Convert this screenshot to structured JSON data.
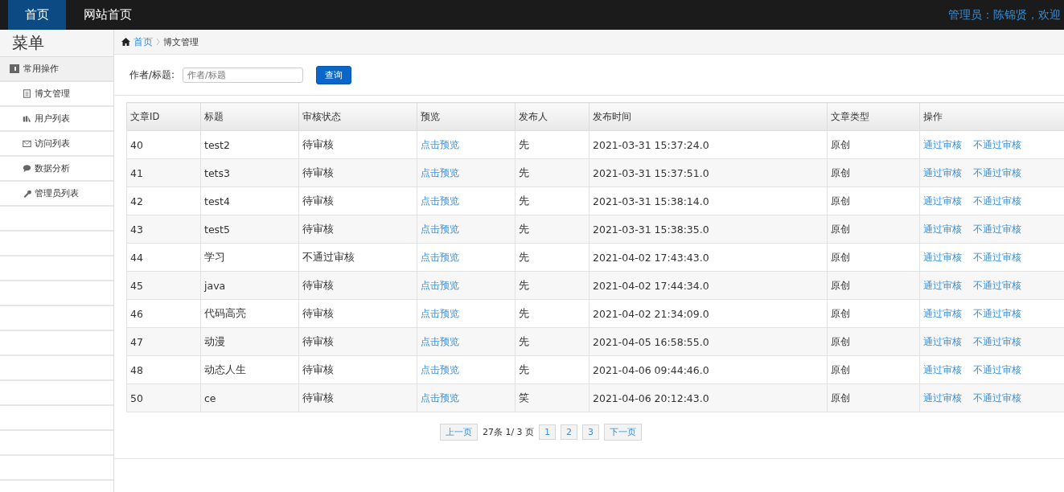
{
  "nav": {
    "items": [
      {
        "label": "首页",
        "selected": true
      },
      {
        "label": "网站首页",
        "selected": false
      }
    ],
    "user": "管理员：陈锦贤，欢迎"
  },
  "sidebar": {
    "title": "菜单",
    "group": "常用操作",
    "items": [
      {
        "label": "博文管理"
      },
      {
        "label": "用户列表"
      },
      {
        "label": "访问列表"
      },
      {
        "label": "数据分析"
      },
      {
        "label": "管理员列表"
      }
    ]
  },
  "breadcrumb": [
    "首页",
    "博文管理"
  ],
  "search": {
    "label": "作者/标题:",
    "placeholder": "作者/标题",
    "button": "查询"
  },
  "table": {
    "columns": [
      "文章ID",
      "标题",
      "审核状态",
      "预览",
      "发布人",
      "发布时间",
      "文章类型",
      "操作"
    ],
    "rows": [
      {
        "id": "40",
        "title": "test2",
        "status": "待审核",
        "preview": "点击预览",
        "author": "先",
        "time": "2021-03-31 15:37:24.0",
        "type": "原创",
        "approve": "通过审核",
        "reject": "不通过审核"
      },
      {
        "id": "41",
        "title": "tets3",
        "status": "待审核",
        "preview": "点击预览",
        "author": "先",
        "time": "2021-03-31 15:37:51.0",
        "type": "原创",
        "approve": "通过审核",
        "reject": "不通过审核"
      },
      {
        "id": "42",
        "title": "test4",
        "status": "待审核",
        "preview": "点击预览",
        "author": "先",
        "time": "2021-03-31 15:38:14.0",
        "type": "原创",
        "approve": "通过审核",
        "reject": "不通过审核"
      },
      {
        "id": "43",
        "title": "test5",
        "status": "待审核",
        "preview": "点击预览",
        "author": "先",
        "time": "2021-03-31 15:38:35.0",
        "type": "原创",
        "approve": "通过审核",
        "reject": "不通过审核"
      },
      {
        "id": "44",
        "title": "学习",
        "status": "不通过审核",
        "preview": "点击预览",
        "author": "先",
        "time": "2021-04-02 17:43:43.0",
        "type": "原创",
        "approve": "通过审核",
        "reject": "不通过审核"
      },
      {
        "id": "45",
        "title": "java",
        "status": "待审核",
        "preview": "点击预览",
        "author": "先",
        "time": "2021-04-02 17:44:34.0",
        "type": "原创",
        "approve": "通过审核",
        "reject": "不通过审核"
      },
      {
        "id": "46",
        "title": "代码高亮",
        "status": "待审核",
        "preview": "点击预览",
        "author": "先",
        "time": "2021-04-02 21:34:09.0",
        "type": "原创",
        "approve": "通过审核",
        "reject": "不通过审核"
      },
      {
        "id": "47",
        "title": "动漫",
        "status": "待审核",
        "preview": "点击预览",
        "author": "先",
        "time": "2021-04-05 16:58:55.0",
        "type": "原创",
        "approve": "通过审核",
        "reject": "不通过审核"
      },
      {
        "id": "48",
        "title": "动态人生",
        "status": "待审核",
        "preview": "点击预览",
        "author": "先",
        "time": "2021-04-06 09:44:46.0",
        "type": "原创",
        "approve": "通过审核",
        "reject": "不通过审核"
      },
      {
        "id": "50",
        "title": "ce",
        "status": "待审核",
        "preview": "点击预览",
        "author": "笑",
        "time": "2021-04-06 20:12:43.0",
        "type": "原创",
        "approve": "通过审核",
        "reject": "不通过审核"
      }
    ]
  },
  "pagination": {
    "prev": "上一页",
    "info": "27条 1/ 3 页",
    "pages": [
      "1",
      "2",
      "3"
    ],
    "next": "下一页"
  }
}
